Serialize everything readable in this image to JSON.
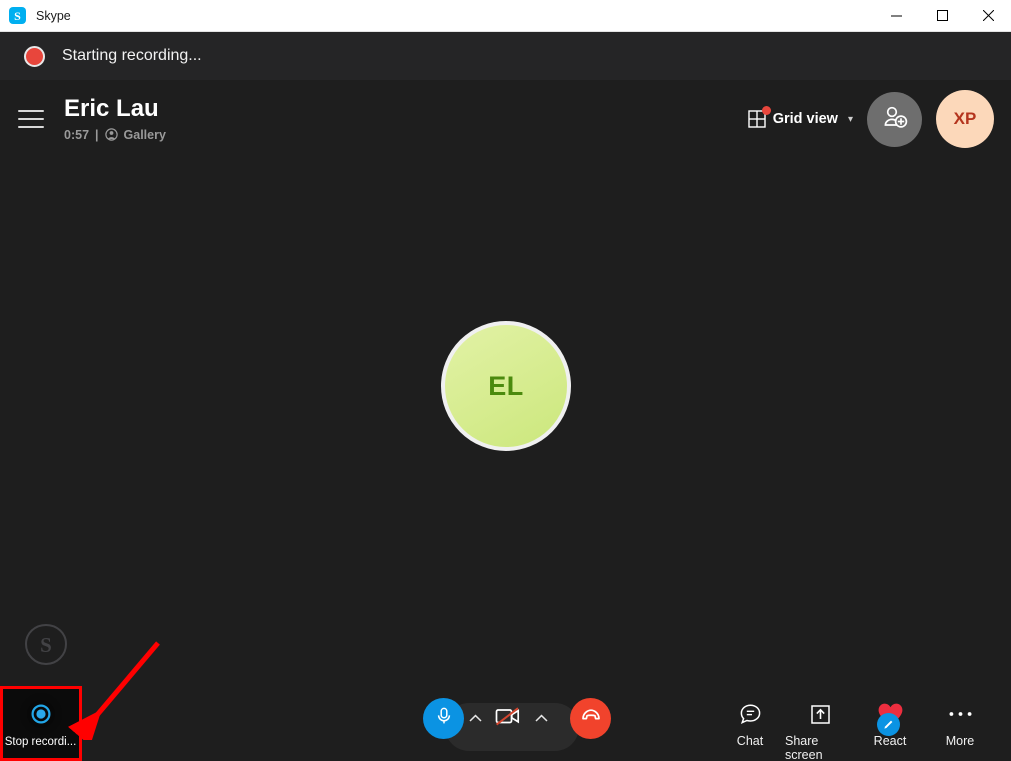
{
  "window": {
    "title": "Skype",
    "app_icon": "skype-icon",
    "controls": {
      "minimize": "minimize-icon",
      "maximize": "maximize-icon",
      "close": "close-icon"
    }
  },
  "recording_banner": {
    "icon": "record-dot-icon",
    "text": "Starting recording...",
    "dot_color": "#e8463c"
  },
  "call_header": {
    "menu_icon": "hamburger-icon",
    "name": "Eric Lau",
    "duration": "0:57",
    "separator": "|",
    "layout_icon": "gallery-icon",
    "layout": "Gallery",
    "grid_view": {
      "label": "Grid view",
      "icon": "grid-icon",
      "chevron": "chevron-down-icon",
      "badge": true,
      "badge_color": "#e8463c"
    },
    "add_people_icon": "add-person-icon",
    "avatar": {
      "initials": "XP",
      "bg": "#fcd8ba",
      "fg": "#b4341d"
    }
  },
  "stage": {
    "participant": {
      "initials": "EL",
      "bg": "#d6ec8f",
      "fg": "#4b8a0e"
    },
    "watermark": "skype-logo-watermark"
  },
  "bottom_bar": {
    "mic": {
      "icon": "microphone-icon",
      "state": "on",
      "color": "#0b93e3"
    },
    "mic_caret": "chevron-up-icon",
    "video": {
      "icon": "video-off-icon",
      "state": "off"
    },
    "video_caret": "chevron-up-icon",
    "hangup": {
      "icon": "end-call-icon",
      "color": "#f1432c"
    },
    "actions": [
      {
        "label": "Chat",
        "icon": "chat-bubble-icon"
      },
      {
        "label": "Share screen",
        "icon": "share-screen-icon"
      },
      {
        "label": "React",
        "icon": "heart-icon",
        "badge_icon": "pencil-icon",
        "badge_color": "#0b93e3",
        "heart_color": "#ed2e3f"
      },
      {
        "label": "More",
        "icon": "ellipsis-icon"
      }
    ]
  },
  "stop_recording": {
    "label": "Stop recordi...",
    "icon": "stop-recording-icon",
    "ring_color": "#22a6e8"
  },
  "annotation": {
    "highlight_color": "#ff0000",
    "arrow": "red-arrow-pointing-down-left"
  }
}
